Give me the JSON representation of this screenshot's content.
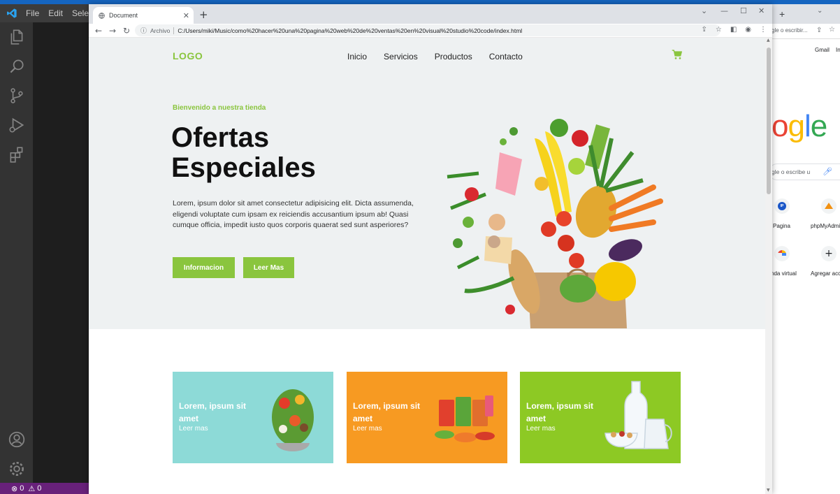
{
  "vscode": {
    "menu": [
      "File",
      "Edit",
      "Sele"
    ],
    "status": {
      "errors": "0",
      "warnings": "0"
    }
  },
  "browser": {
    "tab_title": "Document",
    "address_label": "Archivo",
    "url": "C:/Users/miki/Music/como%20hacer%20una%20pagina%20web%20de%20ventas%20en%20visual%20studio%20code/index.html"
  },
  "page": {
    "logo": "LOGO",
    "nav": [
      "Inicio",
      "Servicios",
      "Productos",
      "Contacto"
    ],
    "welcome": "Bienvenido a nuestra tienda",
    "headline_line1": "Ofertas",
    "headline_line2": "Especiales",
    "body": "Lorem, ipsum dolor sit amet consectetur adipisicing elit. Dicta assumenda, eligendi voluptate cum ipsam ex reiciendis accusantium ipsum ab! Quasi cumque officia, impedit iusto quos corporis quaerat sed sunt asperiores?",
    "btn_info": "Informacion",
    "btn_more": "Leer Mas",
    "cards": [
      {
        "title": "Lorem, ipsum sit amet",
        "link": "Leer mas",
        "color": "#8ddad7"
      },
      {
        "title": "Lorem, ipsum sit amet",
        "link": "Leer mas",
        "color": "#f79a22"
      },
      {
        "title": "Lorem, ipsum sit amet",
        "link": "Leer mas",
        "color": "#8dc924"
      }
    ],
    "accent": "#8ac53e"
  },
  "second_browser": {
    "search_hint": "gle o escribir...",
    "gmail": "Gmail",
    "images": "In",
    "google_partial": "ogle",
    "search_partial": "gle o escribe u",
    "shortcuts": [
      "Pagina",
      "phpMyAdmi",
      "nda virtual",
      "Agregar acc"
    ]
  }
}
